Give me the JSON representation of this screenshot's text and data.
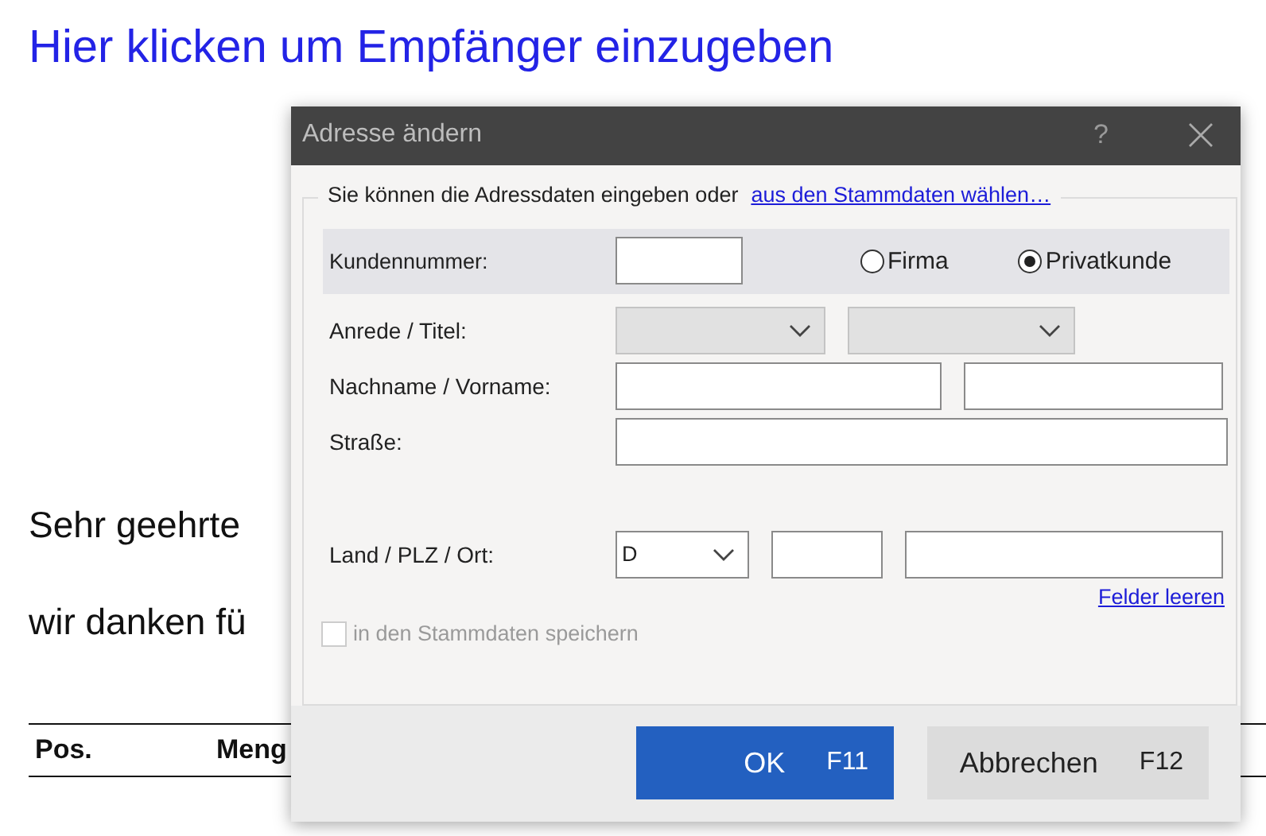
{
  "document": {
    "heading": "Hier klicken um Empfänger einzugeben",
    "paragraphs": [
      "Sehr geehrte",
      "wir danken fü"
    ],
    "table_header": [
      "Pos.",
      "Meng"
    ]
  },
  "dialog": {
    "title": "Adresse ändern",
    "help": "?",
    "intro": "Sie können die Adressdaten eingeben oder",
    "master_link": "aus den Stammdaten wählen…",
    "customer_number_label": "Kundennummer:",
    "customer_types": [
      {
        "label": "Firma",
        "selected": false
      },
      {
        "label": "Privatkunde",
        "selected": true
      }
    ],
    "rows": [
      {
        "label": "Anrede / Titel:",
        "controls": [
          {
            "kind": "select",
            "disabled": true
          },
          {
            "kind": "select",
            "disabled": true
          }
        ]
      },
      {
        "label": "Nachname / Vorname:",
        "controls": [
          {
            "kind": "input"
          },
          {
            "kind": "input"
          }
        ]
      },
      {
        "label": "Straße:",
        "controls": [
          {
            "kind": "input"
          }
        ]
      },
      {
        "label": "Land / PLZ / Ort:",
        "controls": [
          {
            "kind": "select",
            "value": "D",
            "disabled": false
          },
          {
            "kind": "input"
          },
          {
            "kind": "input"
          }
        ]
      }
    ],
    "clear_link": "Felder leeren",
    "save_checkbox": {
      "label": "in den Stammdaten speichern",
      "checked": false,
      "disabled": true
    },
    "buttons": [
      {
        "label": "OK",
        "shortcut": "F11",
        "primary": true
      },
      {
        "label": "Abbrechen",
        "shortcut": "F12",
        "primary": false
      }
    ]
  }
}
